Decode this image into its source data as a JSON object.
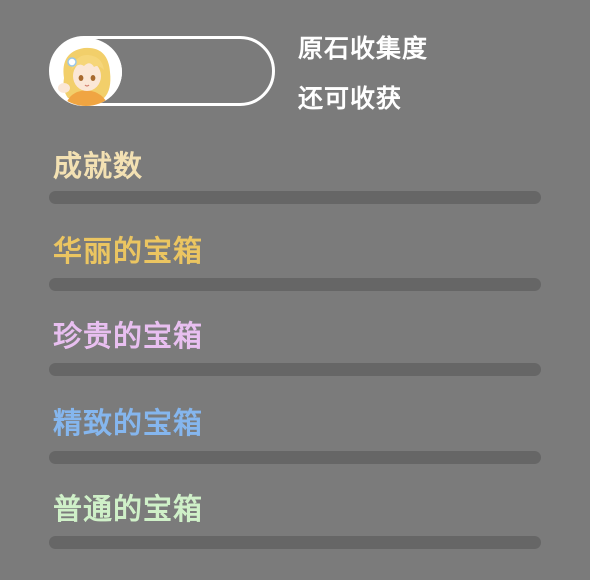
{
  "header": {
    "primogem_label": "原石收集度",
    "collectible_label": "还可收获"
  },
  "rows": [
    {
      "label": "成就数",
      "color": "#f3e1b3",
      "progress": 0
    },
    {
      "label": "华丽的宝箱",
      "color": "#ebc561",
      "progress": 0
    },
    {
      "label": "珍贵的宝箱",
      "color": "#e8bff0",
      "progress": 0
    },
    {
      "label": "精致的宝箱",
      "color": "#85b6ee",
      "progress": 0
    },
    {
      "label": "普通的宝箱",
      "color": "#cff0c8",
      "progress": 0
    }
  ],
  "icons": {
    "avatar": "character-portrait-icon"
  }
}
